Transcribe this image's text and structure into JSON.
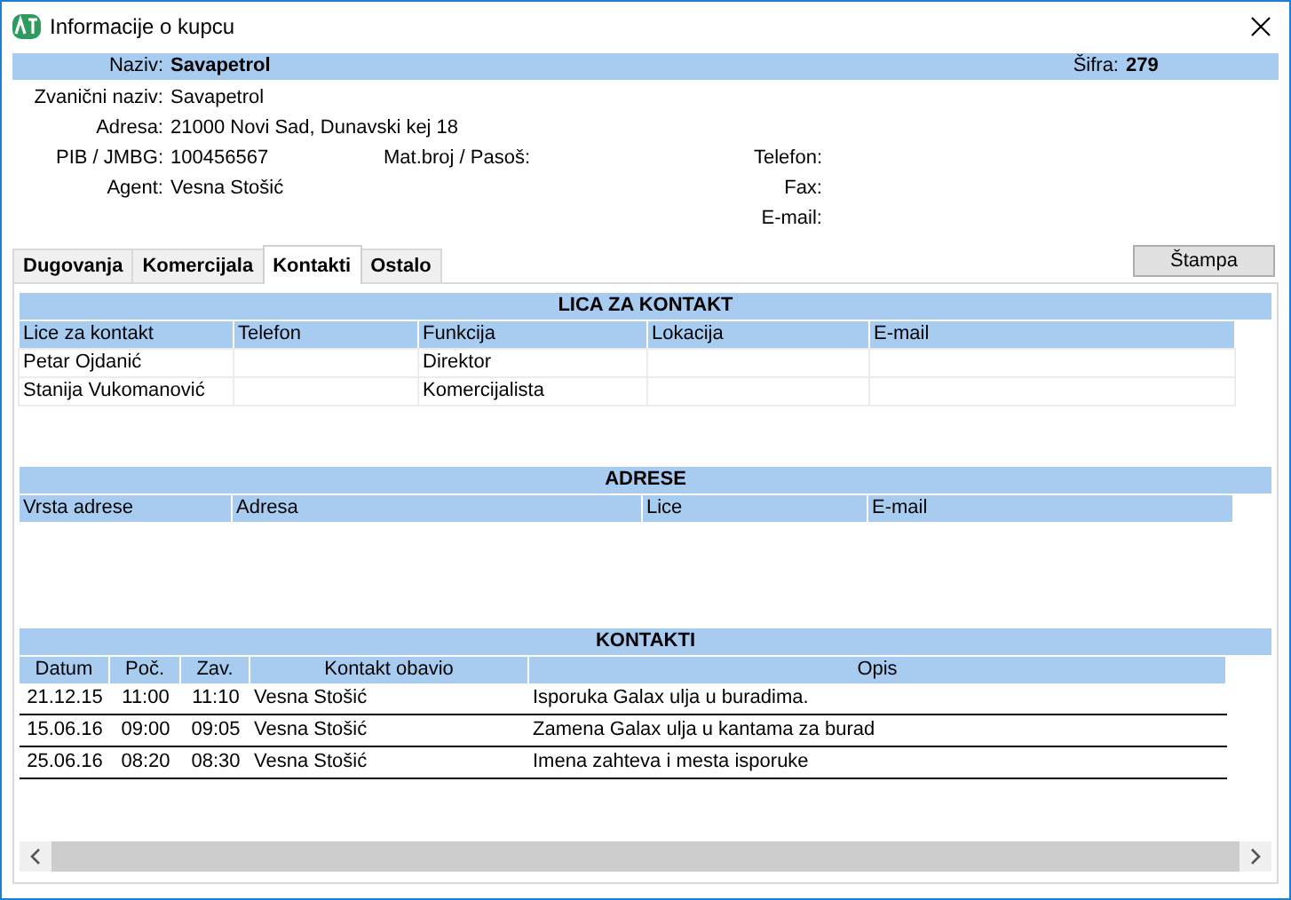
{
  "window": {
    "title": "Informacije o kupcu"
  },
  "header": {
    "name_label": "Naziv:",
    "name": "Savapetrol",
    "code_label": "Šifra:",
    "code": "279"
  },
  "left_fields": [
    {
      "label": "Zvanični naziv:",
      "value": "Savapetrol"
    },
    {
      "label": "Adresa:",
      "value": "21000 Novi Sad, Dunavski kej 18"
    },
    {
      "label": "PIB / JMBG:",
      "value": "100456567"
    },
    {
      "label": "Agent:",
      "value": "Vesna Stošić"
    }
  ],
  "middle_fields": [
    {
      "label": "Mat.broj / Pasoš:"
    }
  ],
  "right_fields": [
    {
      "label": "Telefon:"
    },
    {
      "label": "Fax:"
    },
    {
      "label": "E-mail:"
    }
  ],
  "tabs": [
    {
      "label": "Dugovanja",
      "selected": false
    },
    {
      "label": "Komercijala",
      "selected": false
    },
    {
      "label": "Kontakti",
      "selected": true
    },
    {
      "label": "Ostalo",
      "selected": false
    }
  ],
  "print_button": "Štampa",
  "sections": [
    {
      "title": "LICA ZA KONTAKT",
      "kind": "grid",
      "columns": [
        "Lice za kontakt",
        "Telefon",
        "Funkcija",
        "Lokacija",
        "E-mail"
      ],
      "rows": [
        [
          "Petar Ojdanić",
          null,
          "Direktor",
          null,
          null
        ],
        [
          "Stanija Vukomanović",
          null,
          "Komercijalista",
          null,
          null
        ]
      ]
    },
    {
      "title": "ADRESE",
      "kind": "grid",
      "columns": [
        "Vrsta adrese",
        "Adresa",
        "Lice",
        "E-mail"
      ]
    },
    {
      "title": "KONTAKTI",
      "kind": "lined",
      "columns": [
        "Datum",
        "Poč.",
        "Zav.",
        "Kontakt obavio",
        "Opis"
      ],
      "rows": [
        [
          "21.12.15",
          "11:00",
          "11:10",
          "Vesna Stošić",
          "Isporuka Galax ulja u buradima."
        ],
        [
          "15.06.16",
          "09:00",
          "09:05",
          "Vesna Stošić",
          "Zamena Galax ulja u kantama za burad"
        ],
        [
          "25.06.16",
          "08:20",
          "08:30",
          "Vesna Stošić",
          "Imena zahteva i mesta isporuke"
        ]
      ]
    }
  ]
}
